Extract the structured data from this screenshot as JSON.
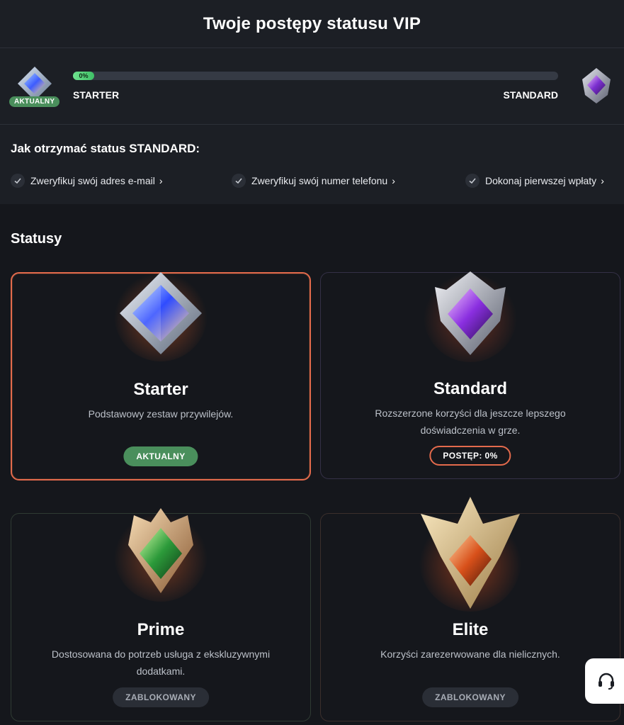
{
  "header": {
    "title": "Twoje postępy statusu VIP"
  },
  "progress": {
    "current_badge": "AKTUALNY",
    "percent_label": "0%",
    "percent": 0,
    "from_level": "STARTER",
    "to_level": "STANDARD"
  },
  "requirements": {
    "title": "Jak otrzymać status STANDARD:",
    "items": [
      {
        "label": "Zweryfikuj swój adres e-mail"
      },
      {
        "label": "Zweryfikuj swój numer telefonu"
      },
      {
        "label": "Dokonaj pierwszej wpłaty"
      }
    ]
  },
  "statuses": {
    "title": "Statusy",
    "cards": [
      {
        "name": "Starter",
        "description": "Podstawowy zestaw przywilejów.",
        "badge": "AKTUALNY",
        "gem_color": "#5a8cff"
      },
      {
        "name": "Standard",
        "description": "Rozszerzone korzyści dla jeszcze lepszego doświadczenia w grze.",
        "badge": "POSTĘP: 0%",
        "gem_color": "#9a4de0"
      },
      {
        "name": "Prime",
        "description": "Dostosowana do potrzeb usługa z ekskluzywnymi dodatkami.",
        "badge": "ZABLOKOWANY",
        "gem_color": "#3fb24a"
      },
      {
        "name": "Elite",
        "description": "Korzyści zarezerwowane dla nielicznych.",
        "badge": "ZABLOKOWANY",
        "gem_color": "#e0561e"
      }
    ]
  },
  "colors": {
    "accent": "#e36a4c",
    "success": "#4a8f5c",
    "background": "#15171c",
    "panel": "#1c1f25"
  },
  "icons": {
    "support": "headset-icon",
    "check": "check-icon",
    "chevron": "chevron-right-icon"
  }
}
